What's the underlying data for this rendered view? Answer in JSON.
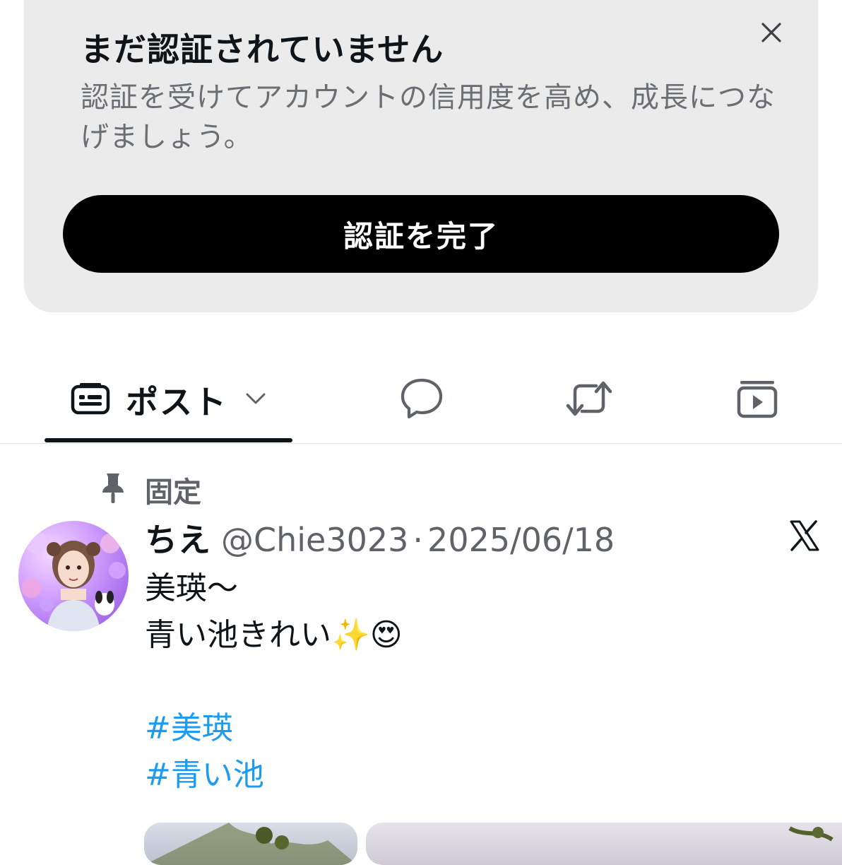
{
  "verification_card": {
    "title": "まだ認証されていません",
    "description": "認証を受けてアカウントの信用度を高め、成長につなげましょう。",
    "button_label": "認証を完了",
    "close_icon": "close-icon"
  },
  "tabs": {
    "posts_label": "ポスト",
    "active": "posts",
    "icons": [
      "posts-tab-icon",
      "chevron-down-icon",
      "reply-bubble-icon",
      "repost-icon",
      "media-play-icon"
    ]
  },
  "post": {
    "pinned_label": "固定",
    "author_name": "ちえ",
    "author_handle": "@Chie3023",
    "separator": "·",
    "date": "2025/06/18",
    "text_line1": "美瑛〜",
    "text_line2": "青い池きれい✨😍",
    "hashtags": [
      "#美瑛",
      "#青い池"
    ]
  },
  "colors": {
    "card_background": "#ebebeb",
    "button_background": "#000000",
    "hashtag": "#1d9bf0",
    "secondary_text": "#5f6368"
  }
}
